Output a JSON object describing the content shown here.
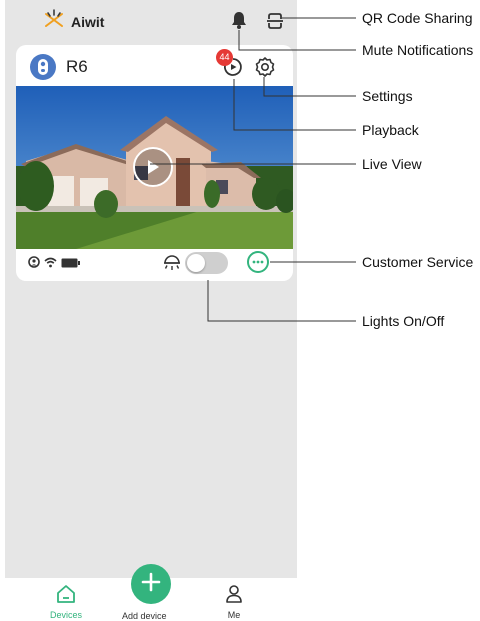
{
  "app": {
    "brand": "Aiwit"
  },
  "device": {
    "name": "R6",
    "playback_badge": "44"
  },
  "icons": {
    "logo": "aiwit-logo-icon",
    "bell": "bell-icon",
    "qr": "qr-code-sharing-icon",
    "camera": "doorbell-camera-icon",
    "playback": "playback-icon",
    "settings": "gear-icon",
    "play": "play-icon",
    "signal": "signal-icon",
    "wifi": "wifi-icon",
    "battery": "battery-icon",
    "light": "light-icon",
    "chat": "chat-icon",
    "home": "home-icon",
    "add": "plus-icon",
    "user": "user-icon"
  },
  "toggle": {
    "lights_on": false
  },
  "nav": {
    "devices": "Devices",
    "add_device": "Add device",
    "me": "Me"
  },
  "annotations": {
    "qr_sharing": "QR Code Sharing",
    "mute": "Mute Notifications",
    "settings": "Settings",
    "playback": "Playback",
    "live_view": "Live View",
    "customer_service": "Customer Service",
    "lights": "Lights On/Off"
  },
  "colors": {
    "accent": "#33b47e",
    "badge": "#e53935",
    "avatar": "#4a78c4"
  }
}
